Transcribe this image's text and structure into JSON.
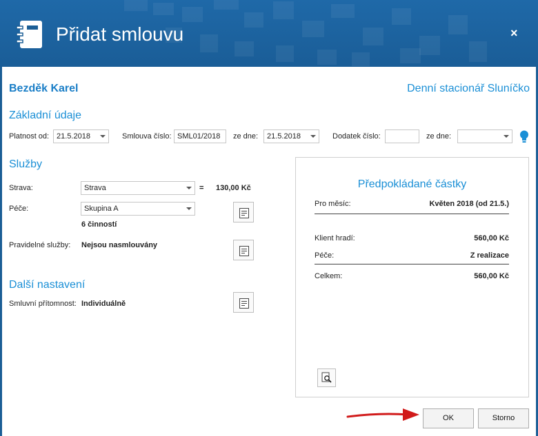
{
  "dialog": {
    "title": "Přidat smlouvu",
    "close_glyph": "×"
  },
  "client": {
    "name": "Bezděk Karel",
    "facility": "Denní stacionář Sluníčko"
  },
  "basic": {
    "heading": "Základní údaje",
    "validity_label": "Platnost od:",
    "validity_value": "21.5.2018",
    "contract_no_label": "Smlouva číslo:",
    "contract_no_value": "SML01/2018",
    "dated_label": "ze dne:",
    "dated_value": "21.5.2018",
    "addendum_label": "Dodatek číslo:",
    "addendum_value": "",
    "addendum_dated_label": "ze dne:",
    "addendum_dated_value": ""
  },
  "services": {
    "heading": "Služby",
    "meal_label": "Strava:",
    "meal_value": "Strava",
    "equals": "=",
    "meal_price": "130,00 Kč",
    "care_label": "Péče:",
    "care_value": "Skupina A",
    "care_activities": "6 činností",
    "regular_label": "Pravidelné služby:",
    "regular_value": "Nejsou nasmlouvány"
  },
  "other": {
    "heading": "Další nastavení",
    "presence_label": "Smluvní přítomnost:",
    "presence_value": "Individuálně"
  },
  "estimate": {
    "heading": "Předpokládané částky",
    "month_label": "Pro měsíc:",
    "month_value": "Květen 2018 (od 21.5.)",
    "client_pays_label": "Klient hradí:",
    "client_pays_value": "560,00 Kč",
    "care_label": "Péče:",
    "care_value": "Z realizace",
    "total_label": "Celkem:",
    "total_value": "560,00 Kč"
  },
  "buttons": {
    "ok": "OK",
    "cancel": "Storno"
  },
  "colors": {
    "header": "#1b5e96",
    "accent": "#1a8fd6",
    "arrow": "#d11a1a",
    "hint": "#1a8fd6"
  },
  "icons": [
    "notebook-icon",
    "close-icon",
    "lightbulb-icon",
    "document-icon",
    "preview-icon",
    "chevron-down-icon"
  ]
}
